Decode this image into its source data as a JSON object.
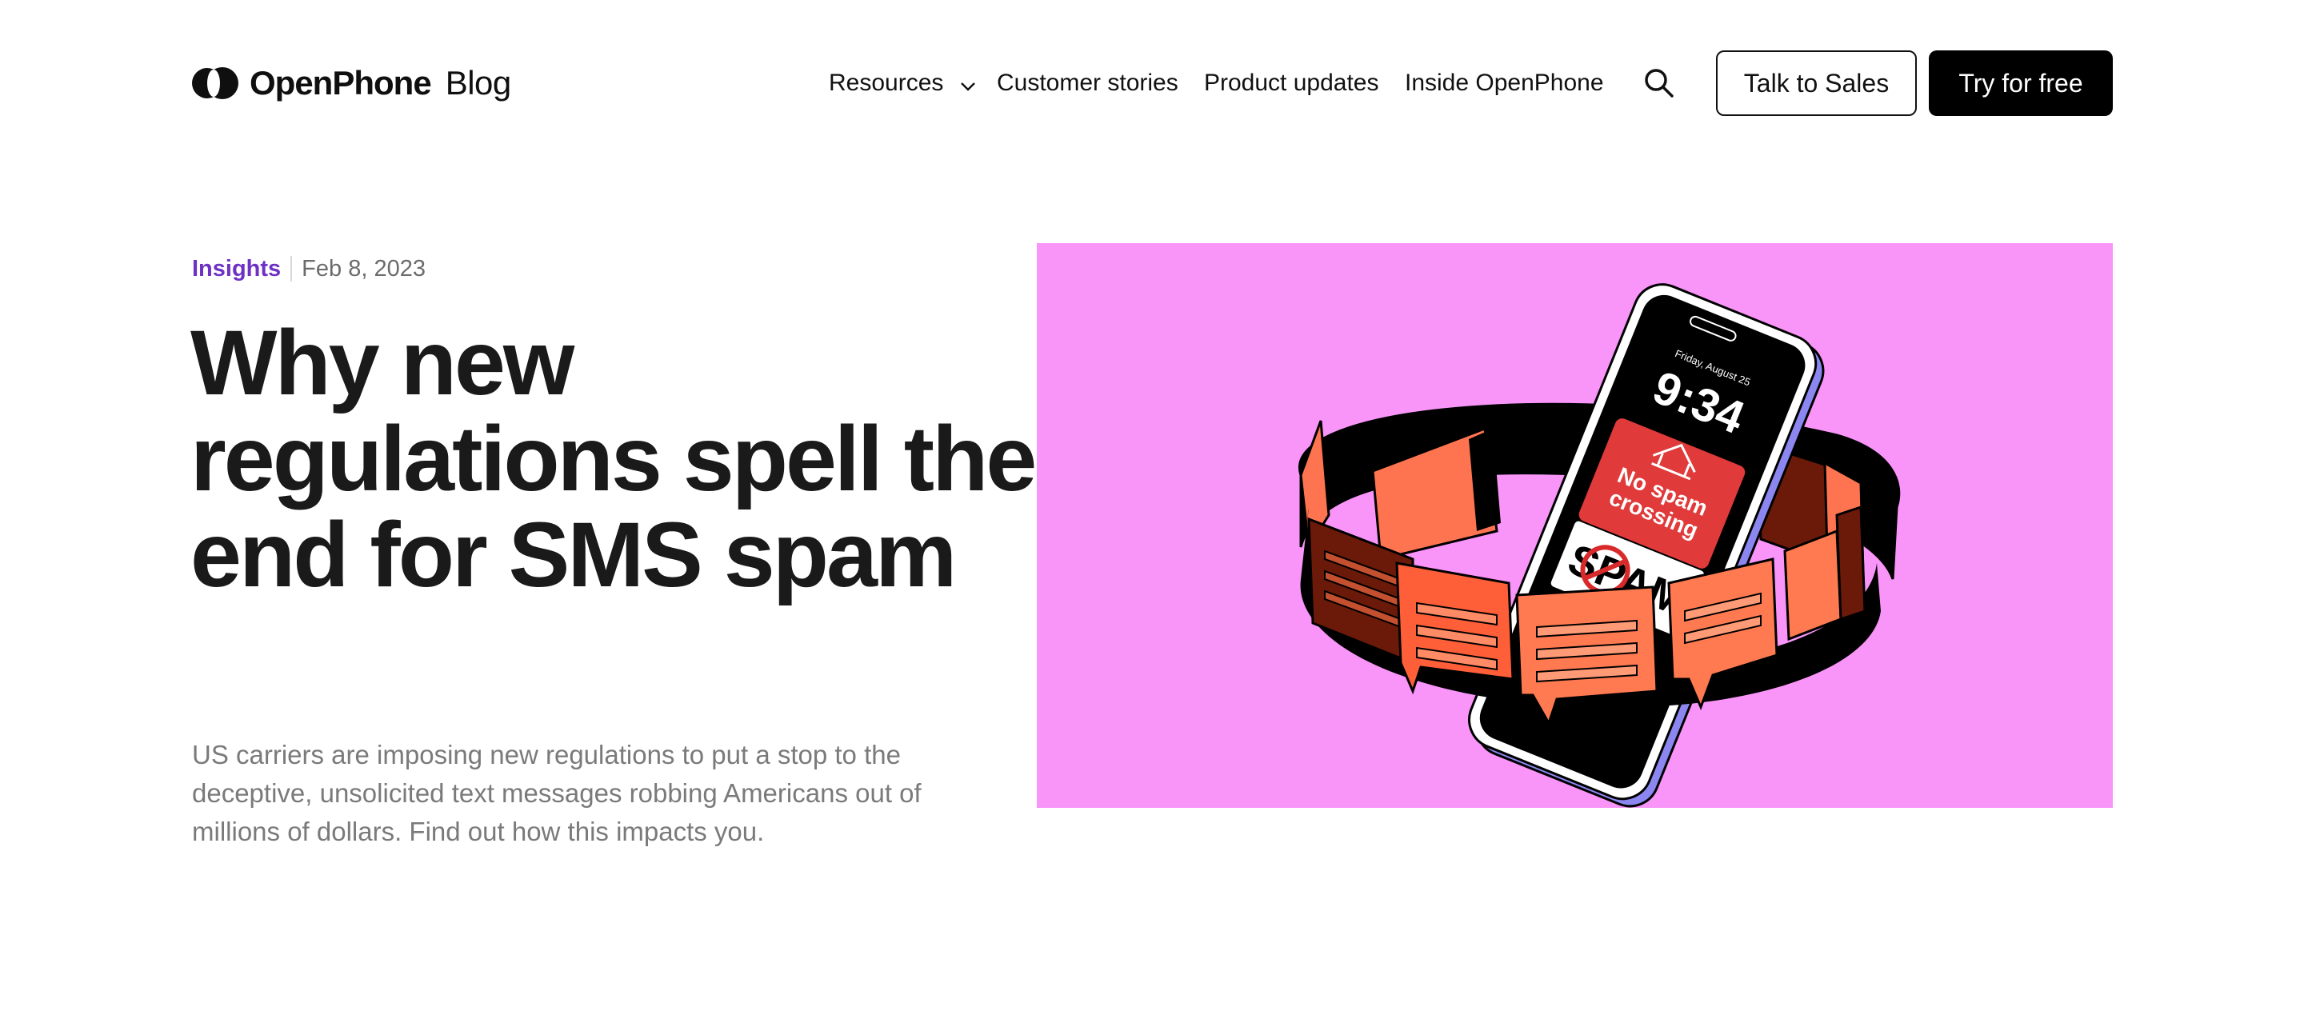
{
  "header": {
    "brand_name": "OpenPhone",
    "brand_suffix": "Blog",
    "nav": [
      {
        "label": "Resources",
        "has_dropdown": true
      },
      {
        "label": "Customer stories"
      },
      {
        "label": "Product updates"
      },
      {
        "label": "Inside OpenPhone"
      }
    ],
    "search_icon": "search-icon",
    "talk_to_sales": "Talk to Sales",
    "try_for_free": "Try for free"
  },
  "article": {
    "category": "Insights",
    "date": "Feb 8, 2023",
    "title": "Why new regulations spell the end for SMS spam",
    "subtitle": "US carriers are imposing new regulations to put a stop to the deceptive, unsolicited text messages robbing Americans out of millions of dollars. Find out how this impacts you."
  },
  "hero": {
    "background": "#f995f9",
    "phone_date": "Friday, August 25",
    "phone_time": "9:34",
    "notification_text_1": "No spam",
    "notification_text_2": "crossing",
    "spam_label": "SPAM"
  },
  "colors": {
    "accent": "#6d32c4",
    "button_dark": "#000000"
  }
}
